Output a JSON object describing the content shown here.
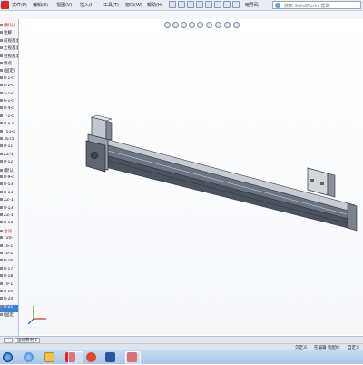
{
  "menubar": {
    "items": [
      "文件(F)",
      "编辑(E)",
      "视图(V)",
      "插入(I)",
      "工具(T)",
      "窗口(W)",
      "帮助(H)"
    ],
    "extra_label": "暗号码",
    "help_placeholder": "搜索 SolidWorks 帮助"
  },
  "tree": {
    "items": [
      {
        "label": "(默认)",
        "style": "red"
      },
      {
        "label": "注解",
        "style": ""
      },
      {
        "label": "前视基准面",
        "style": ""
      },
      {
        "label": "上视基准面",
        "style": ""
      },
      {
        "label": "右视基准面",
        "style": ""
      },
      {
        "label": "原点",
        "style": ""
      },
      {
        "label": "(固定)",
        "style": ""
      },
      {
        "label": "8-1<",
        "style": ""
      },
      {
        "label": "8-2<",
        "style": ""
      },
      {
        "label": "5-1<",
        "style": ""
      },
      {
        "label": "6-1<",
        "style": ""
      },
      {
        "label": "8-4<",
        "style": ""
      },
      {
        "label": "7-1<",
        "style": ""
      },
      {
        "label": "8-1<",
        "style": ""
      },
      {
        "label": "T51<",
        "style": ""
      },
      {
        "label": "3ST5",
        "style": ""
      },
      {
        "label": "8-11",
        "style": ""
      },
      {
        "label": "ZZ-1",
        "style": ""
      },
      {
        "label": "8-12",
        "style": ""
      },
      {
        "label": "(默认",
        "style": ""
      },
      {
        "label": "8-9<",
        "style": ""
      },
      {
        "label": "8-13",
        "style": ""
      },
      {
        "label": "8-13",
        "style": ""
      },
      {
        "label": "ZZ-1",
        "style": ""
      },
      {
        "label": "8-13",
        "style": ""
      },
      {
        "label": "ZZ-1",
        "style": ""
      },
      {
        "label": "8-14",
        "style": ""
      },
      {
        "label": "合词",
        "style": "red"
      },
      {
        "label": "720-",
        "style": ""
      },
      {
        "label": "16-1",
        "style": ""
      },
      {
        "label": "16-2",
        "style": ""
      },
      {
        "label": "8-16",
        "style": ""
      },
      {
        "label": "8-17",
        "style": ""
      },
      {
        "label": "8-18",
        "style": ""
      },
      {
        "label": "19-1",
        "style": ""
      },
      {
        "label": "8-19",
        "style": ""
      },
      {
        "label": "8-20",
        "style": ""
      },
      {
        "label": "8-21",
        "style": "sel"
      },
      {
        "label": "(固定",
        "style": ""
      }
    ]
  },
  "bottom_tabs": {
    "active": "运动算例 1"
  },
  "status": {
    "left": "欠定义",
    "middle": "在编辑 装配体",
    "right": "自定义"
  },
  "taskbar": {
    "icons": [
      "start-orb",
      "ie",
      "explorer",
      "pdf",
      "wps",
      "word",
      "solidworks"
    ]
  },
  "colors": {
    "accent": "#3d7fd6",
    "model_body": "#5a6270",
    "taskbar": "#b5d0ef"
  }
}
